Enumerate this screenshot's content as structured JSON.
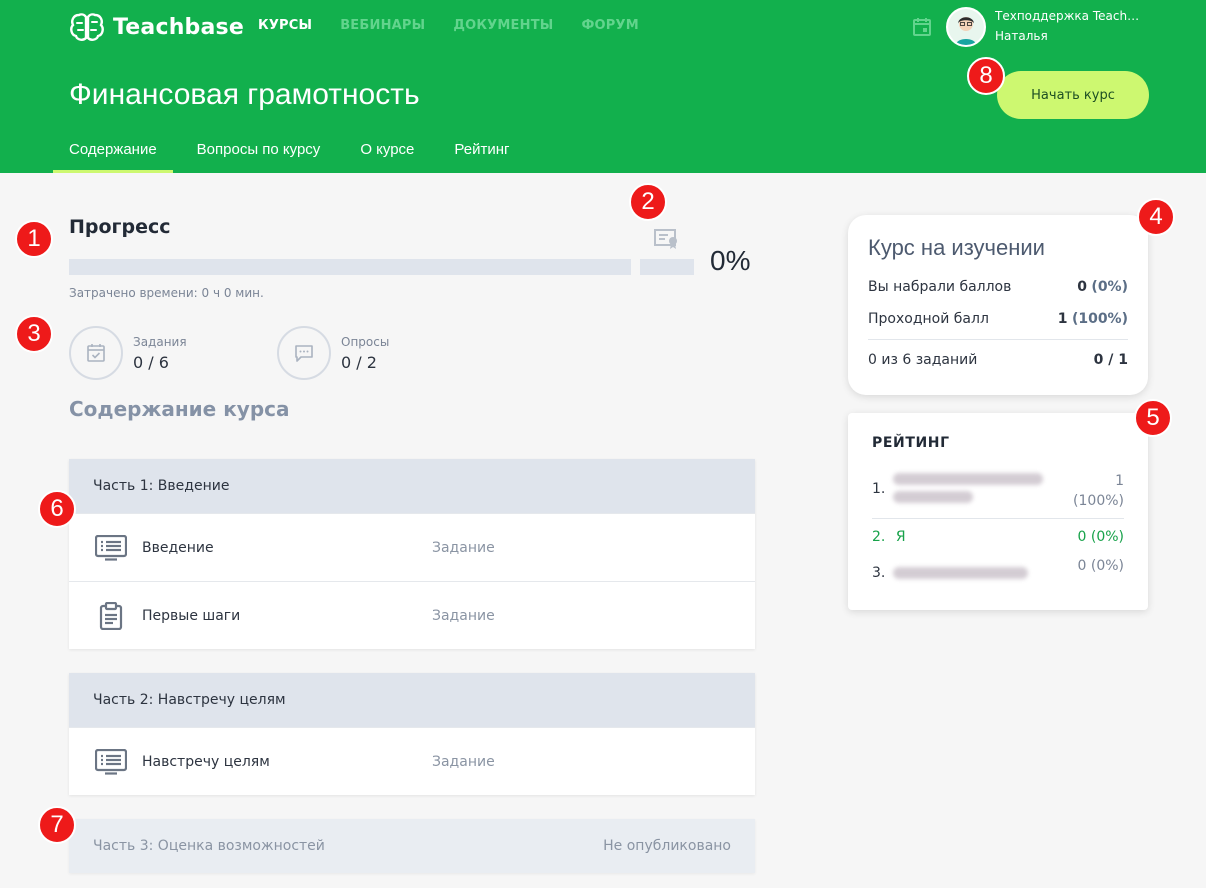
{
  "header": {
    "logo_text": "Teachbase",
    "nav": [
      {
        "label": "КУРСЫ",
        "active": true
      },
      {
        "label": "ВЕБИНАРЫ",
        "active": false
      },
      {
        "label": "ДОКУМЕНТЫ",
        "active": false
      },
      {
        "label": "ФОРУМ",
        "active": false
      }
    ],
    "user_name": "Техподдержка Teachbase",
    "user_sub": "Наталья",
    "course_title": "Финансовая грамотность",
    "start_button": "Начать курс",
    "tabs": [
      {
        "label": "Содержание",
        "active": true
      },
      {
        "label": "Вопросы по курсу",
        "active": false
      },
      {
        "label": "О курсе",
        "active": false
      },
      {
        "label": "Рейтинг",
        "active": false
      }
    ]
  },
  "markers": [
    "1",
    "2",
    "3",
    "4",
    "5",
    "6",
    "7",
    "8"
  ],
  "progress": {
    "title": "Прогресс",
    "percent_label": "0%",
    "percent": 0,
    "time_spent": "Затрачено времени: 0 ч 0 мин.",
    "tasks_label": "Задания",
    "tasks_value": "0 / 6",
    "polls_label": "Опросы",
    "polls_value": "0 / 2"
  },
  "content": {
    "heading": "Содержание курса",
    "parts": [
      {
        "title": "Часть 1: Введение",
        "rows": [
          {
            "title": "Введение",
            "type": "Задание",
            "icon": "presentation-icon"
          },
          {
            "title": "Первые шаги",
            "type": "Задание",
            "icon": "clipboard-icon"
          }
        ]
      },
      {
        "title": "Часть 2: Навстречу целям",
        "rows": [
          {
            "title": "Навстречу целям",
            "type": "Задание",
            "icon": "presentation-icon"
          }
        ]
      }
    ],
    "unpublished_part": {
      "title": "Часть 3: Оценка возможностей",
      "status": "Не опубликовано"
    }
  },
  "study_card": {
    "title": "Курс на изучении",
    "score_label": "Вы набрали баллов",
    "score_value": "0",
    "score_pct": "(0%)",
    "pass_label": "Проходной балл",
    "pass_value": "1",
    "pass_pct": "(100%)",
    "tasks_label": "0 из 6 заданий",
    "tasks_value": "0 / 1"
  },
  "rating": {
    "title": "РЕЙТИНГ",
    "rows": [
      {
        "rank": "1.",
        "value_line1": "1",
        "value_line2": "(100%)"
      },
      {
        "rank": "2.",
        "name": "Я",
        "value": "0 (0%)"
      },
      {
        "rank": "3.",
        "value": "0 (0%)"
      }
    ]
  },
  "colors": {
    "brand_green": "#12b04d",
    "accent_lime": "#cdf870",
    "marker_red": "#ee1a1a"
  }
}
